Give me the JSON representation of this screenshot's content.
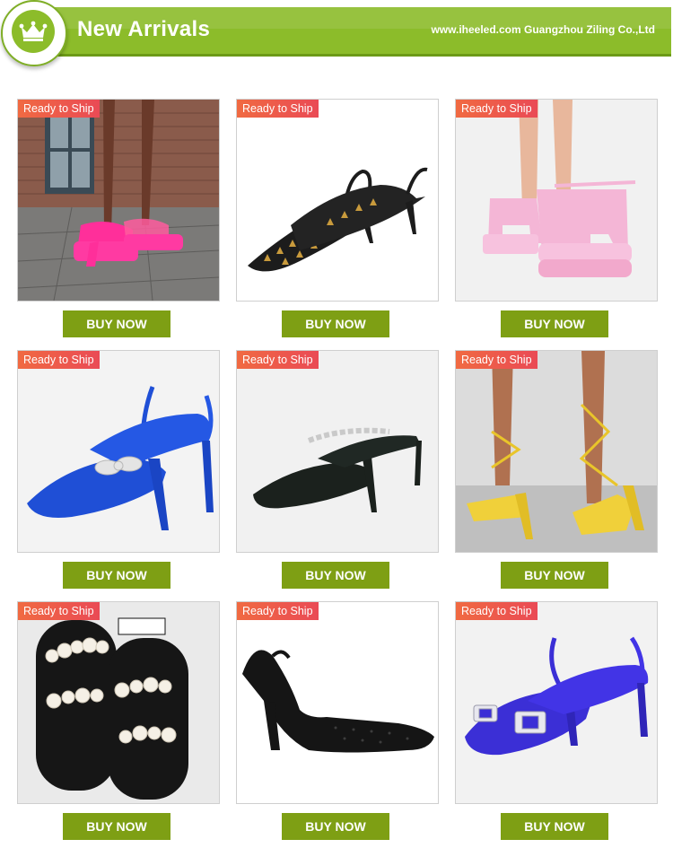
{
  "header": {
    "title": "New Arrivals",
    "site": "www.iheeled.com Guangzhou Ziling Co.,Ltd",
    "logo_icon": "crown-icon",
    "accent": "#8cbc2a"
  },
  "products": [
    {
      "tag": "Ready to Ship",
      "button": "BUY NOW",
      "image": "pink-platform-mule-photo"
    },
    {
      "tag": "Ready to Ship",
      "button": "BUY NOW",
      "image": "black-studded-slingback-photo"
    },
    {
      "tag": "Ready to Ship",
      "button": "BUY NOW",
      "image": "pink-platform-sandal-photo"
    },
    {
      "tag": "Ready to Ship",
      "button": "BUY NOW",
      "image": "blue-bow-slingback-photo"
    },
    {
      "tag": "Ready to Ship",
      "button": "BUY NOW",
      "image": "black-chain-mule-photo"
    },
    {
      "tag": "Ready to Ship",
      "button": "BUY NOW",
      "image": "yellow-lace-up-heel-photo"
    },
    {
      "tag": "Ready to Ship",
      "button": "BUY NOW",
      "image": "pearl-flat-slide-photo"
    },
    {
      "tag": "Ready to Ship",
      "button": "BUY NOW",
      "image": "black-rhinestone-slingback-photo"
    },
    {
      "tag": "Ready to Ship",
      "button": "BUY NOW",
      "image": "purple-crystal-buckle-slingback-photo"
    }
  ],
  "colors": {
    "button": "#7e9f14",
    "tag_start": "#f06a42",
    "tag_end": "#ea4a55"
  }
}
